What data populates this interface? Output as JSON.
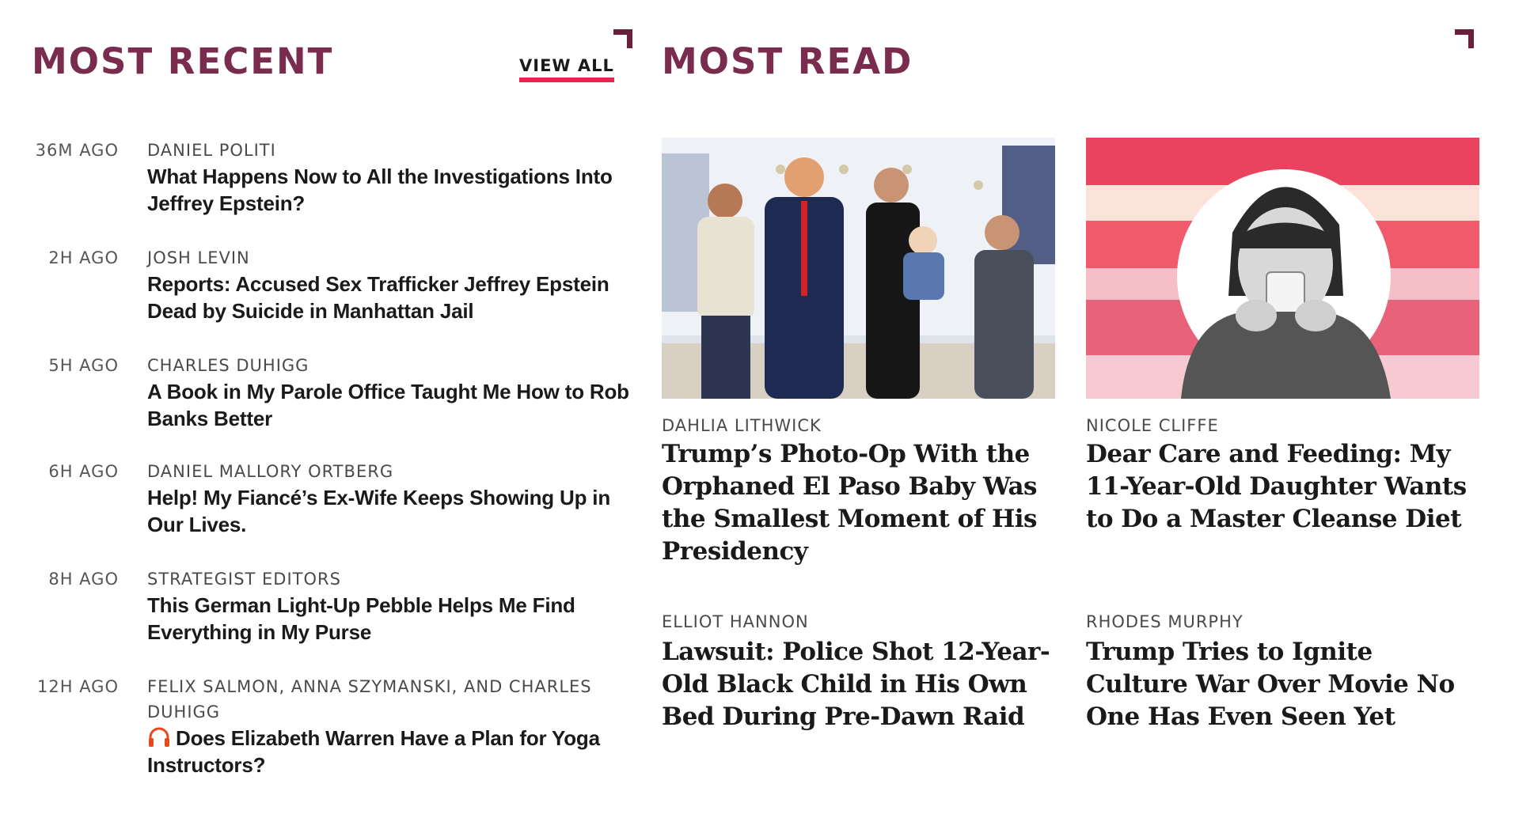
{
  "most_recent": {
    "title": "MOST RECENT",
    "view_all_label": "VIEW ALL",
    "items": [
      {
        "time": "36M AGO",
        "author": "DANIEL POLITI",
        "headline": "What Happens Now to All the Investigations Into Jeffrey Epstein?"
      },
      {
        "time": "2H AGO",
        "author": "JOSH LEVIN",
        "headline": "Reports: Accused Sex Trafficker Jeffrey Epstein Dead by Suicide in Manhattan Jail"
      },
      {
        "time": "5H AGO",
        "author": "CHARLES DUHIGG",
        "headline": "A Book in My Parole Office Taught Me How to Rob Banks Better"
      },
      {
        "time": "6H AGO",
        "author": "DANIEL MALLORY ORTBERG",
        "headline": "Help! My Fiancé’s Ex-Wife Keeps Showing Up in Our Lives."
      },
      {
        "time": "8H AGO",
        "author": "STRATEGIST EDITORS",
        "headline": "This German Light-Up Pebble Helps Me Find Everything in My Purse"
      },
      {
        "time": "12H AGO",
        "author": "FELIX SALMON, ANNA SZYMANSKI, AND CHARLES DUHIGG",
        "headline": "Does Elizabeth Warren Have a Plan for Yoga Instructors?",
        "icon": "headphones-icon"
      }
    ]
  },
  "most_read": {
    "title": "MOST READ",
    "cards": [
      {
        "author": "DAHLIA LITHWICK",
        "headline": "Trump’s Photo-Op With the Orphaned El Paso Baby Was the Smallest Moment of His Presidency",
        "image": "group-photo"
      },
      {
        "author": "NICOLE CLIFFE",
        "headline": "Dear Care and Feeding: My 11-Year-Old Daughter Wants to Do a Master Cleanse Diet",
        "image": "girl-drinking-water-illustration"
      },
      {
        "author": "ELLIOT HANNON",
        "headline": "Lawsuit: Police Shot 12-Year-Old Black Child in His Own Bed During Pre-Dawn Raid"
      },
      {
        "author": "RHODES MURPHY",
        "headline": "Trump Tries to Ignite Culture War Over Movie No One Has Even Seen Yet"
      }
    ]
  },
  "colors": {
    "accent": "#7a2c4e",
    "link_underline": "#e8224d",
    "icon": "#e8481c"
  }
}
